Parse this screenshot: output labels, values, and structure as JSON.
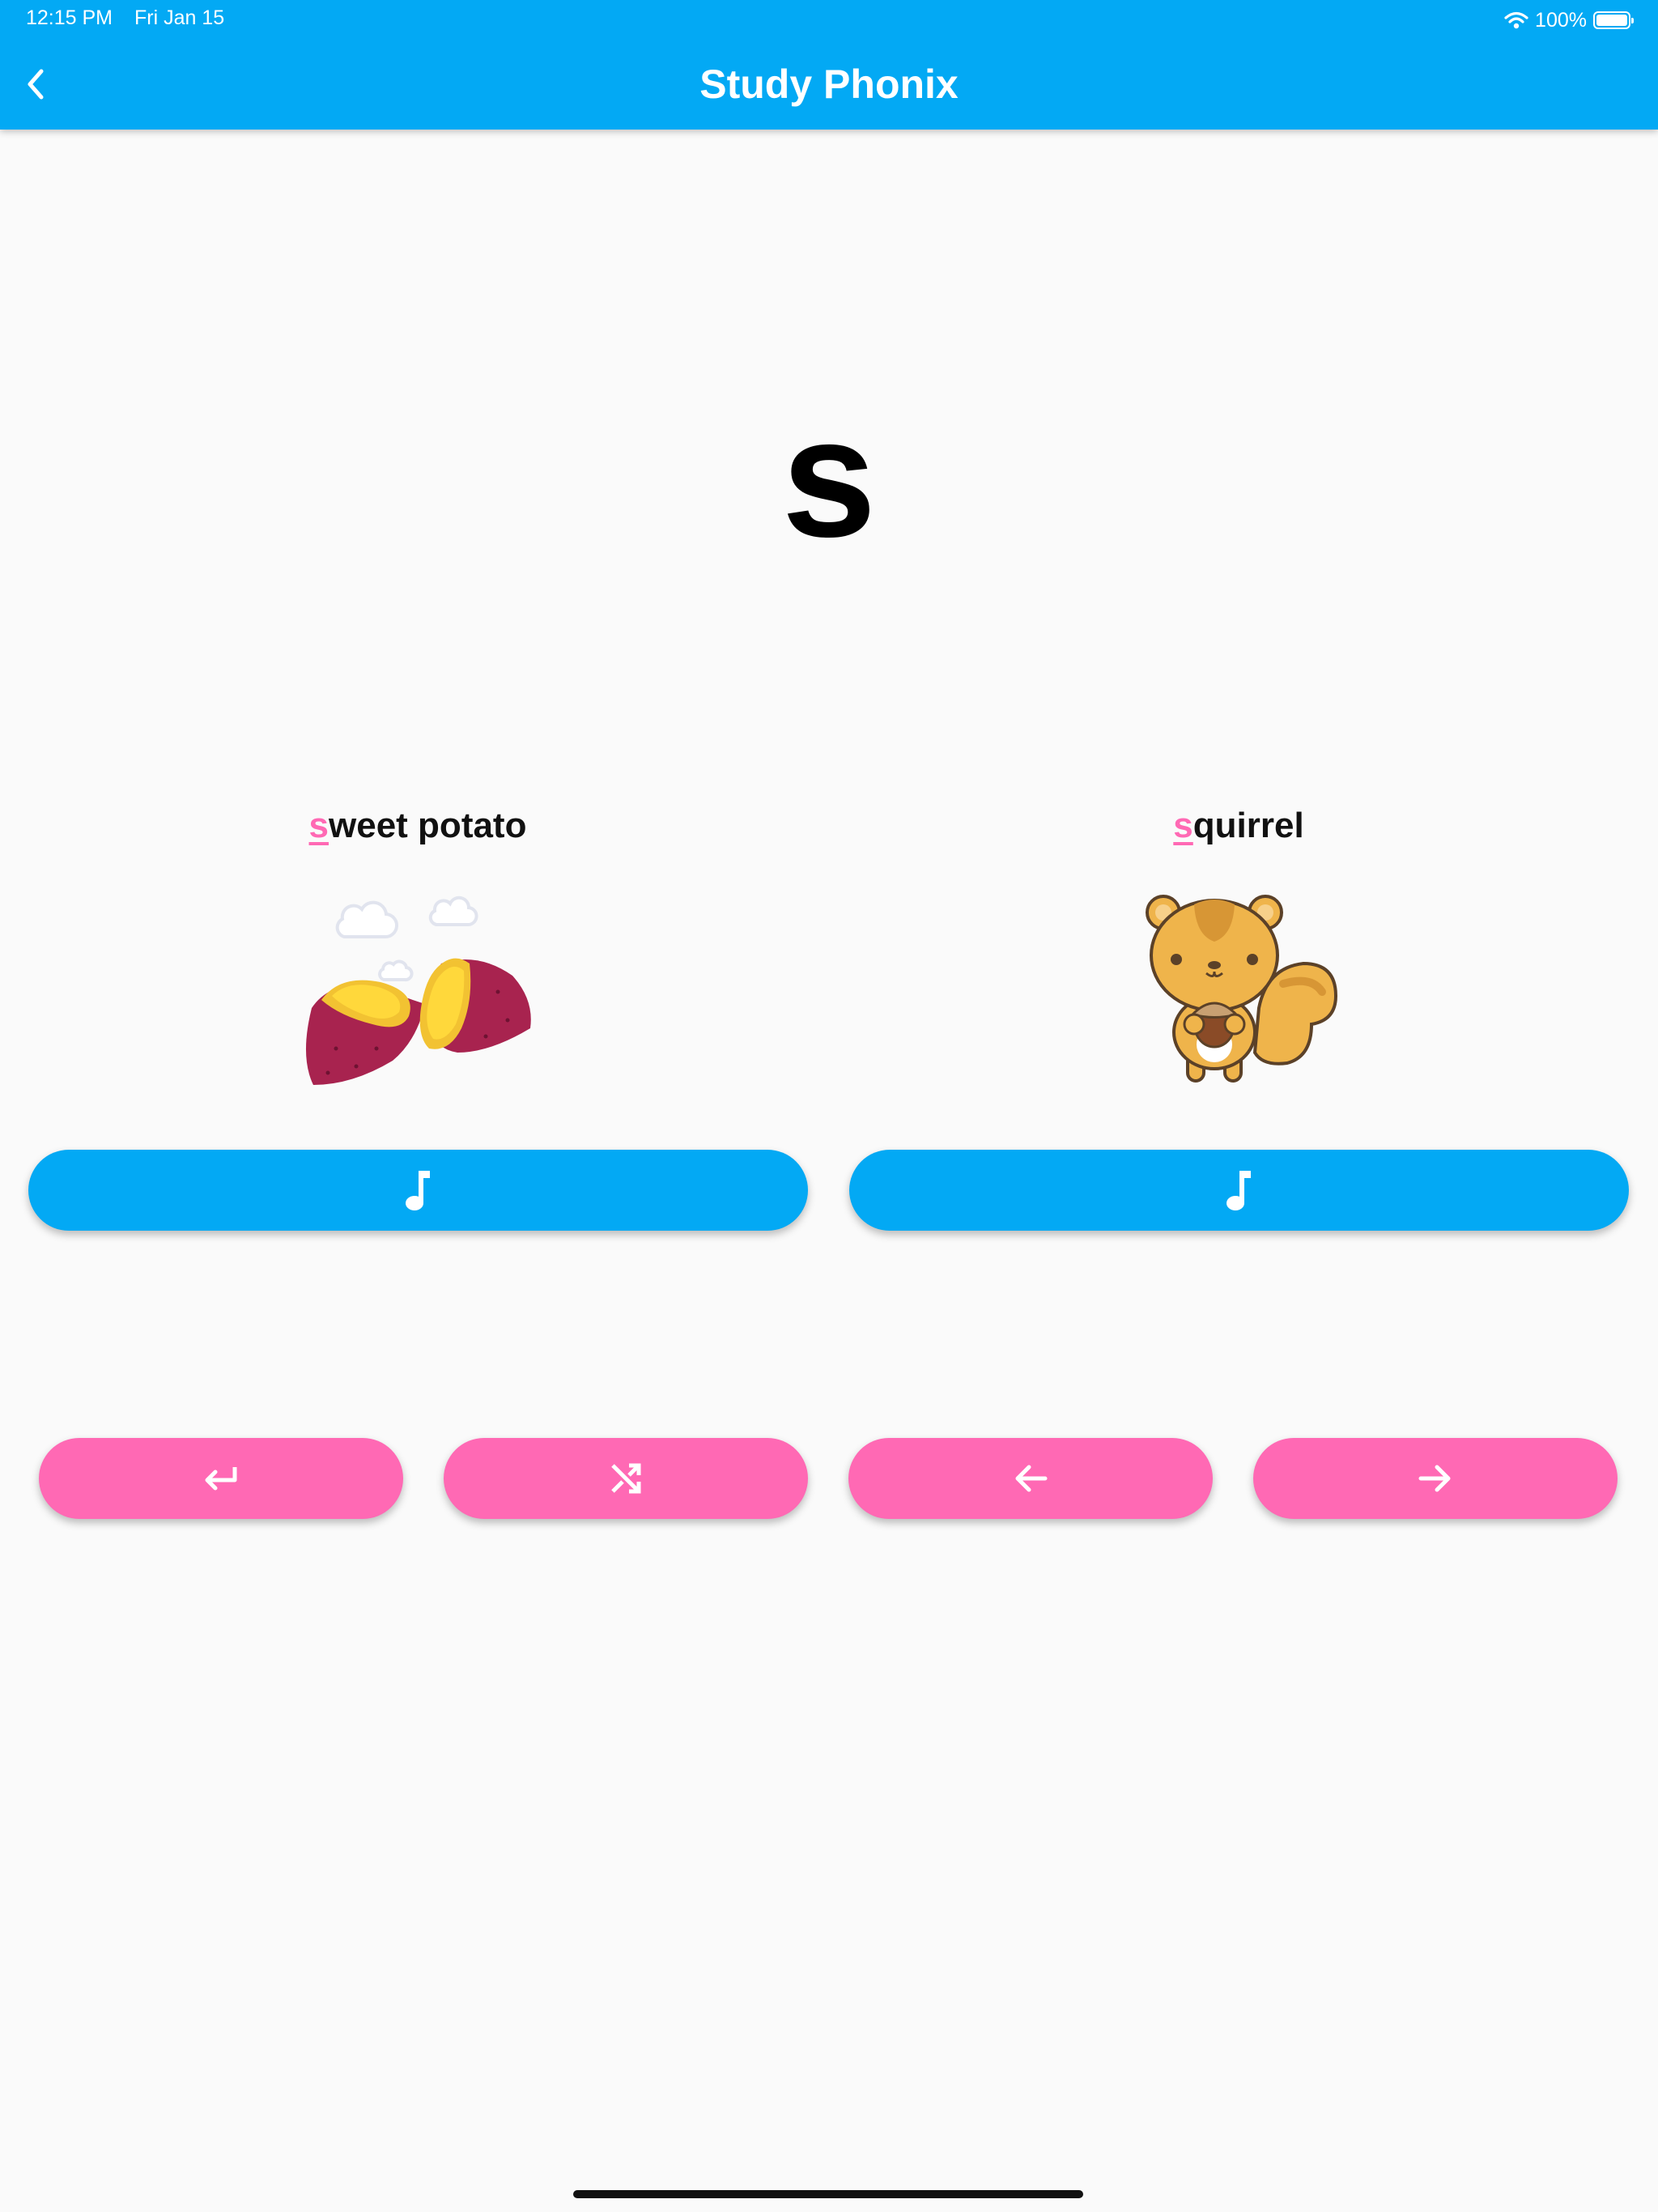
{
  "status_bar": {
    "time": "12:15 PM",
    "date": "Fri Jan 15",
    "battery": "100%"
  },
  "app_bar": {
    "title": "Study Phonix"
  },
  "letter": "s",
  "words": [
    {
      "highlight": "s",
      "rest": "weet potato"
    },
    {
      "highlight": "s",
      "rest": "quirrel"
    }
  ],
  "colors": {
    "app_bar": "#03a9f4",
    "sound_button": "#03a9f4",
    "nav_button": "#ff69b4",
    "highlight": "#ff69b4"
  },
  "icons": {
    "back": "chevron-left-icon",
    "sound": "music-note-icon",
    "nav": [
      "return-icon",
      "shuffle-icon",
      "arrow-left-icon",
      "arrow-right-icon"
    ]
  }
}
